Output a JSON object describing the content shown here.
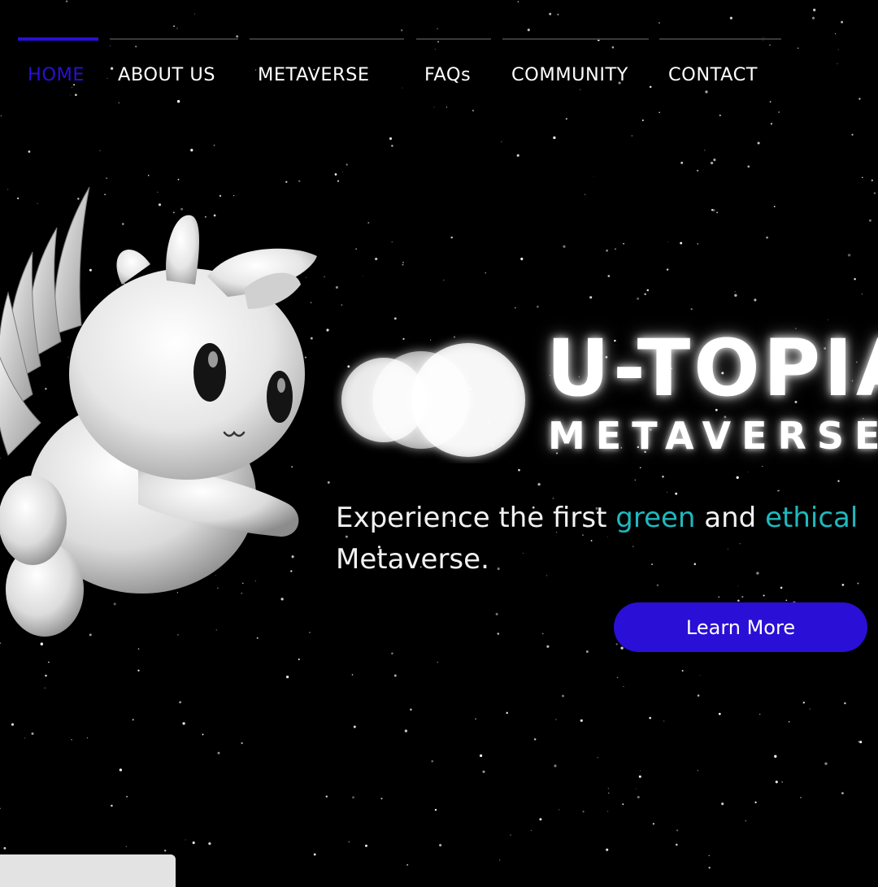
{
  "nav": {
    "items": [
      {
        "label": "HOME",
        "active": true
      },
      {
        "label": "ABOUT US",
        "active": false
      },
      {
        "label": "METAVERSE",
        "active": false
      },
      {
        "label": "FAQs",
        "active": false
      },
      {
        "label": "COMMUNITY",
        "active": false
      },
      {
        "label": "CONTACT",
        "active": false
      }
    ]
  },
  "hero": {
    "logo_title": "U-TOPIA",
    "logo_subtitle": "METAVERSE",
    "tagline_start": "Experience the first ",
    "tagline_green": "green",
    "tagline_middle": " and ",
    "tagline_ethical": "ethical",
    "tagline_end": "Metaverse.",
    "cta_label": "Learn More",
    "mascot_icon": "winged-unicorn-mascot-icon",
    "logo_icon": "overlapping-circles-logo-icon"
  },
  "colors": {
    "accent": "#2a0fd6",
    "nav_active_text": "#2a0fd6",
    "highlight": "#1fb8bd",
    "background": "#000000",
    "line": "#3a3a3a"
  }
}
